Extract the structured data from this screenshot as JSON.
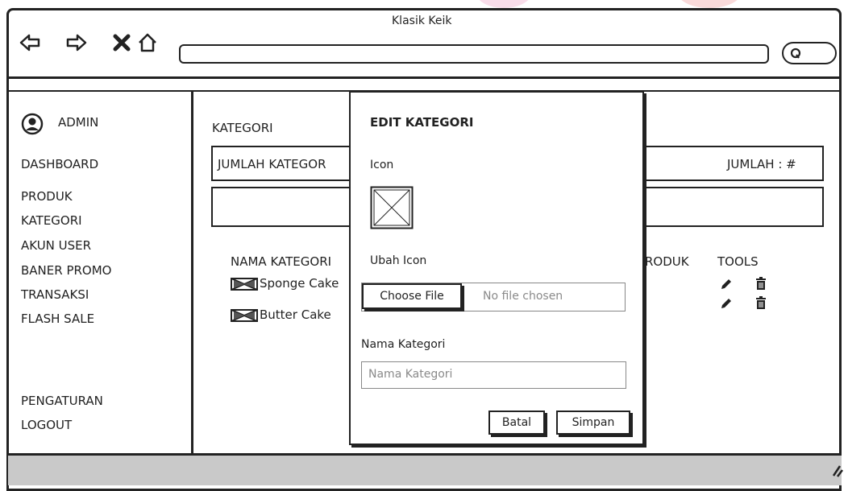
{
  "window": {
    "title": "Klasik Keik"
  },
  "browser": {
    "nav_icons": [
      "back-arrow-icon",
      "forward-arrow-icon",
      "close-icon",
      "home-icon"
    ],
    "search_icon": "search-icon"
  },
  "sidebar": {
    "user": "ADMIN",
    "items": [
      "DASHBOARD",
      "PRODUK",
      "KATEGORI",
      "AKUN USER",
      "BANER PROMO",
      "TRANSAKSI",
      "FLASH SALE"
    ],
    "bottom_items": [
      "PENGATURAN",
      "LOGOUT"
    ]
  },
  "main": {
    "heading": "KATEGORI",
    "summary_label": "JUMLAH KATEGOR",
    "summary_count": "JUMLAH : #",
    "table": {
      "col_name": "NAMA KATEGORI",
      "col_produk": "RODUK",
      "col_tools": "TOOLS",
      "rows": [
        {
          "name": "Sponge Cake"
        },
        {
          "name": "Butter Cake"
        }
      ]
    }
  },
  "modal": {
    "title": "EDIT KATEGORI",
    "icon_label": "Icon",
    "change_icon_label": "Ubah Icon",
    "choose_file": "Choose File",
    "no_file": "No file chosen",
    "name_label": "Nama Kategori",
    "name_placeholder": "Nama Kategori",
    "cancel": "Batal",
    "save": "Simpan"
  },
  "colors": {
    "ink": "#222222",
    "footer": "#c9c9c9",
    "placeholder": "#8a8a8a"
  }
}
